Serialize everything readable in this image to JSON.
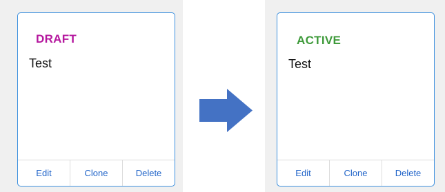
{
  "before": {
    "status_label": "DRAFT",
    "status_color": "#b5179e",
    "title": "Test",
    "actions": [
      "Edit",
      "Clone",
      "Delete"
    ]
  },
  "after": {
    "status_label": "ACTIVE",
    "status_color": "#3e9a3a",
    "title": "Test",
    "actions": [
      "Edit",
      "Clone",
      "Delete"
    ]
  },
  "arrow_icon": "arrow-right-icon",
  "colors": {
    "card_border": "#3b8fde",
    "action_text": "#1f63c8",
    "arrow_fill": "#4472c4",
    "panel_background": "#f0f0f0"
  }
}
